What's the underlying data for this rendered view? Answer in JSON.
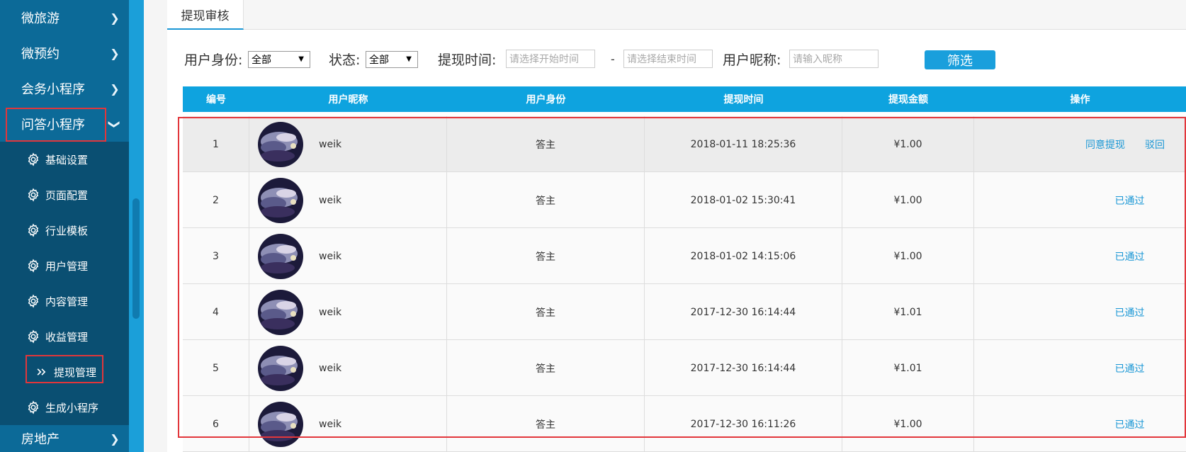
{
  "sidebar": {
    "top_items": [
      {
        "label": "微旅游"
      },
      {
        "label": "微预约"
      },
      {
        "label": "会务小程序"
      },
      {
        "label": "问答小程序"
      }
    ],
    "sub_items": [
      {
        "label": "基础设置",
        "icon": "gear-icon"
      },
      {
        "label": "页面配置",
        "icon": "gear-icon"
      },
      {
        "label": "行业模板",
        "icon": "gear-icon"
      },
      {
        "label": "用户管理",
        "icon": "gear-icon"
      },
      {
        "label": "内容管理",
        "icon": "gear-icon"
      },
      {
        "label": "收益管理",
        "icon": "gear-icon"
      },
      {
        "label": "提现管理",
        "icon": "double-chevron-icon"
      },
      {
        "label": "生成小程序",
        "icon": "gear-icon"
      }
    ],
    "bottom_item": {
      "label": "房地产"
    }
  },
  "tab": {
    "label": "提现审核"
  },
  "filters": {
    "identity_label": "用户身份:",
    "identity_value": "全部",
    "status_label": "状态:",
    "status_value": "全部",
    "time_label": "提现时间:",
    "start_placeholder": "请选择开始时间",
    "dash": "-",
    "end_placeholder": "请选择结束时间",
    "nickname_label": "用户昵称:",
    "nickname_placeholder": "请输入昵称",
    "filter_button": "筛选"
  },
  "table": {
    "headers": [
      "编号",
      "用户昵称",
      "用户身份",
      "提现时间",
      "提现金额",
      "操作"
    ],
    "rows": [
      {
        "id": "1",
        "nickname": "weik",
        "identity": "答主",
        "time": "2018-01-11 18:25:36",
        "amount": "¥1.00",
        "approve": "同意提现",
        "reject": "驳回"
      },
      {
        "id": "2",
        "nickname": "weik",
        "identity": "答主",
        "time": "2018-01-02 15:30:41",
        "amount": "¥1.00",
        "status": "已通过"
      },
      {
        "id": "3",
        "nickname": "weik",
        "identity": "答主",
        "time": "2018-01-02 14:15:06",
        "amount": "¥1.00",
        "status": "已通过"
      },
      {
        "id": "4",
        "nickname": "weik",
        "identity": "答主",
        "time": "2017-12-30 16:14:44",
        "amount": "¥1.01",
        "status": "已通过"
      },
      {
        "id": "5",
        "nickname": "weik",
        "identity": "答主",
        "time": "2017-12-30 16:14:44",
        "amount": "¥1.01",
        "status": "已通过"
      },
      {
        "id": "6",
        "nickname": "weik",
        "identity": "答主",
        "time": "2017-12-30 16:11:26",
        "amount": "¥1.00",
        "status": "已通过"
      }
    ]
  },
  "colors": {
    "accent": "#1a9fdc",
    "sidebar": "#0b5f88",
    "highlight": "#e2363b"
  }
}
